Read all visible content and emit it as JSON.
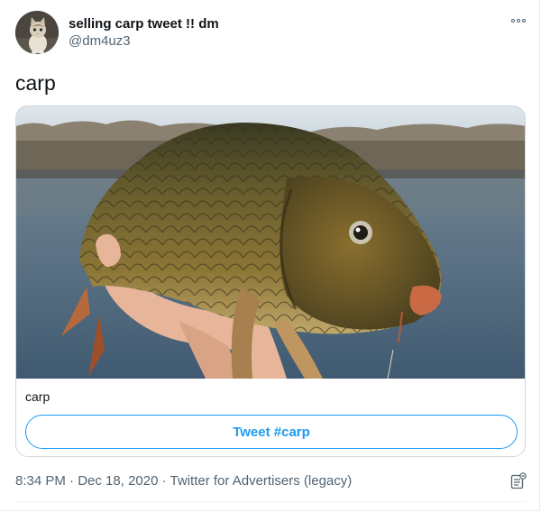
{
  "author": {
    "display_name": "selling carp tweet !! dm",
    "handle": "@dm4uz3",
    "avatar_icon": "cat-avatar"
  },
  "more_menu": {
    "icon": "more-options-icon"
  },
  "tweet": {
    "text": "carp"
  },
  "card": {
    "image_icon": "carp-fish-photo",
    "caption": "carp",
    "cta_label": "Tweet #carp"
  },
  "meta": {
    "time": "8:34 PM",
    "separator": "·",
    "date": "Dec 18, 2020",
    "source": "Twitter for Advertisers (legacy)"
  },
  "colors": {
    "accent": "#1d9bf0",
    "secondary_text": "#536471",
    "primary_text": "#0f1419",
    "border": "#cfd9de"
  }
}
